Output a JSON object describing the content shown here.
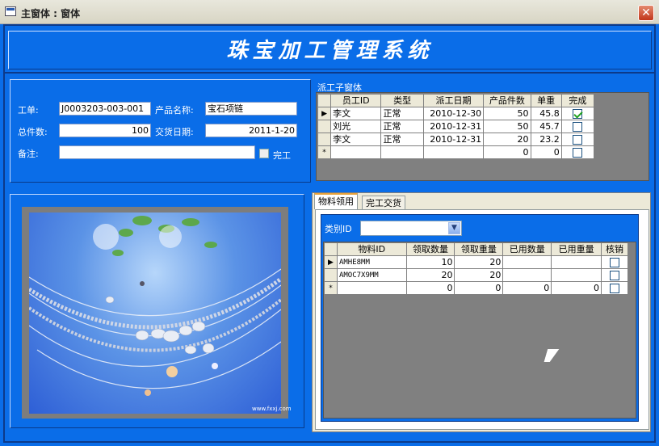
{
  "window": {
    "title": "主窗体 : 窗体",
    "close_icon": "close-icon"
  },
  "header": {
    "title": "珠宝加工管理系统"
  },
  "form": {
    "order_label": "工单:",
    "order_value": "J0003203-003-001",
    "product_label": "产品名称:",
    "product_value": "宝石项链",
    "total_label": "总件数:",
    "total_value": "100",
    "delivery_label": "交货日期:",
    "delivery_value": "2011-1-20",
    "notes_label": "备注:",
    "notes_value": "",
    "done_label": "完工",
    "done_checked": false
  },
  "image": {
    "caption": "www.fxxj.com"
  },
  "subform": {
    "label": "派工子窗体",
    "columns": [
      "员工ID",
      "类型",
      "派工日期",
      "产品件数",
      "单重",
      "完成"
    ],
    "rows": [
      {
        "sel": "▶",
        "emp": "李文",
        "type": "正常",
        "date": "2010-12-30",
        "qty": "50",
        "weight": "45.8",
        "done": true
      },
      {
        "sel": "",
        "emp": "刘光",
        "type": "正常",
        "date": "2010-12-31",
        "qty": "50",
        "weight": "45.7",
        "done": false
      },
      {
        "sel": "",
        "emp": "李文",
        "type": "正常",
        "date": "2010-12-31",
        "qty": "20",
        "weight": "23.2",
        "done": false
      },
      {
        "sel": "*",
        "emp": "",
        "type": "",
        "date": "",
        "qty": "0",
        "weight": "0",
        "done": false
      }
    ]
  },
  "tabs": {
    "tab1": "物料领用",
    "tab2": "完工交货"
  },
  "materials": {
    "category_label": "类别ID",
    "category_value": "",
    "columns": [
      "物料ID",
      "领取数量",
      "领取重量",
      "已用数量",
      "已用重量",
      "核销"
    ],
    "rows": [
      {
        "sel": "▶",
        "id": "AMHE8MM",
        "qty": "10",
        "weight": "20",
        "used_qty": "",
        "used_weight": "",
        "checked": false
      },
      {
        "sel": "",
        "id": "AMOC7X9MM",
        "qty": "20",
        "weight": "20",
        "used_qty": "",
        "used_weight": "",
        "checked": false
      },
      {
        "sel": "*",
        "id": "",
        "qty": "0",
        "weight": "0",
        "used_qty": "0",
        "used_weight": "0",
        "checked": false
      }
    ]
  }
}
